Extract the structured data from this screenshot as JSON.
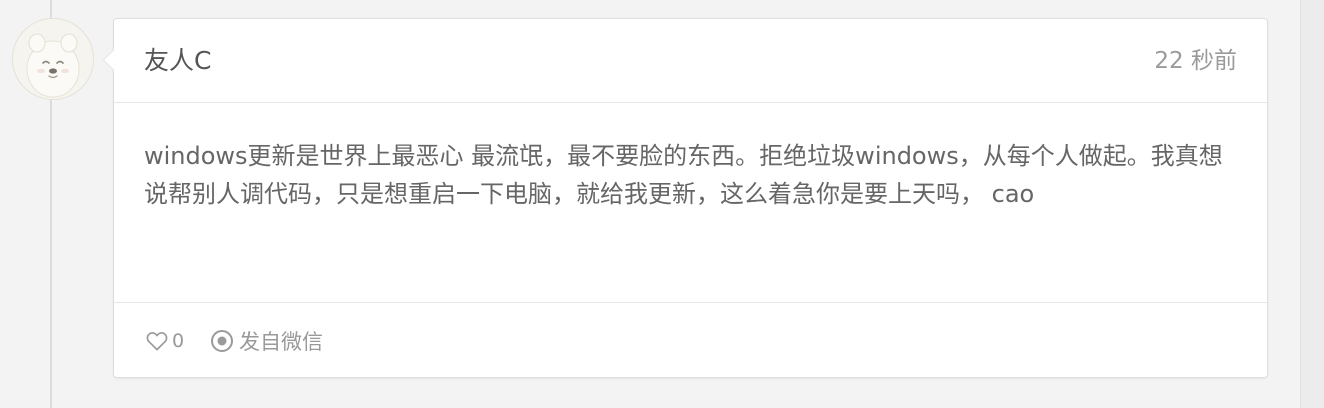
{
  "post": {
    "author": "友人C",
    "time": "22 秒前",
    "content": "windows更新是世界上最恶心 最流氓，最不要脸的东西。拒绝垃圾windows，从每个人做起。我真想说帮别人调代码，只是想重启一下电脑，就给我更新，这么着急你是要上天吗， cao",
    "likes": "0",
    "source": "发自微信"
  },
  "icons": {
    "avatar": "polar-bear-avatar",
    "like": "heart-outline-icon",
    "source": "radio-target-icon"
  },
  "colors": {
    "page_background": "#f3f3f3",
    "card_background": "#ffffff",
    "border": "#dedede",
    "text_primary": "#555555",
    "text_secondary": "#999999"
  }
}
